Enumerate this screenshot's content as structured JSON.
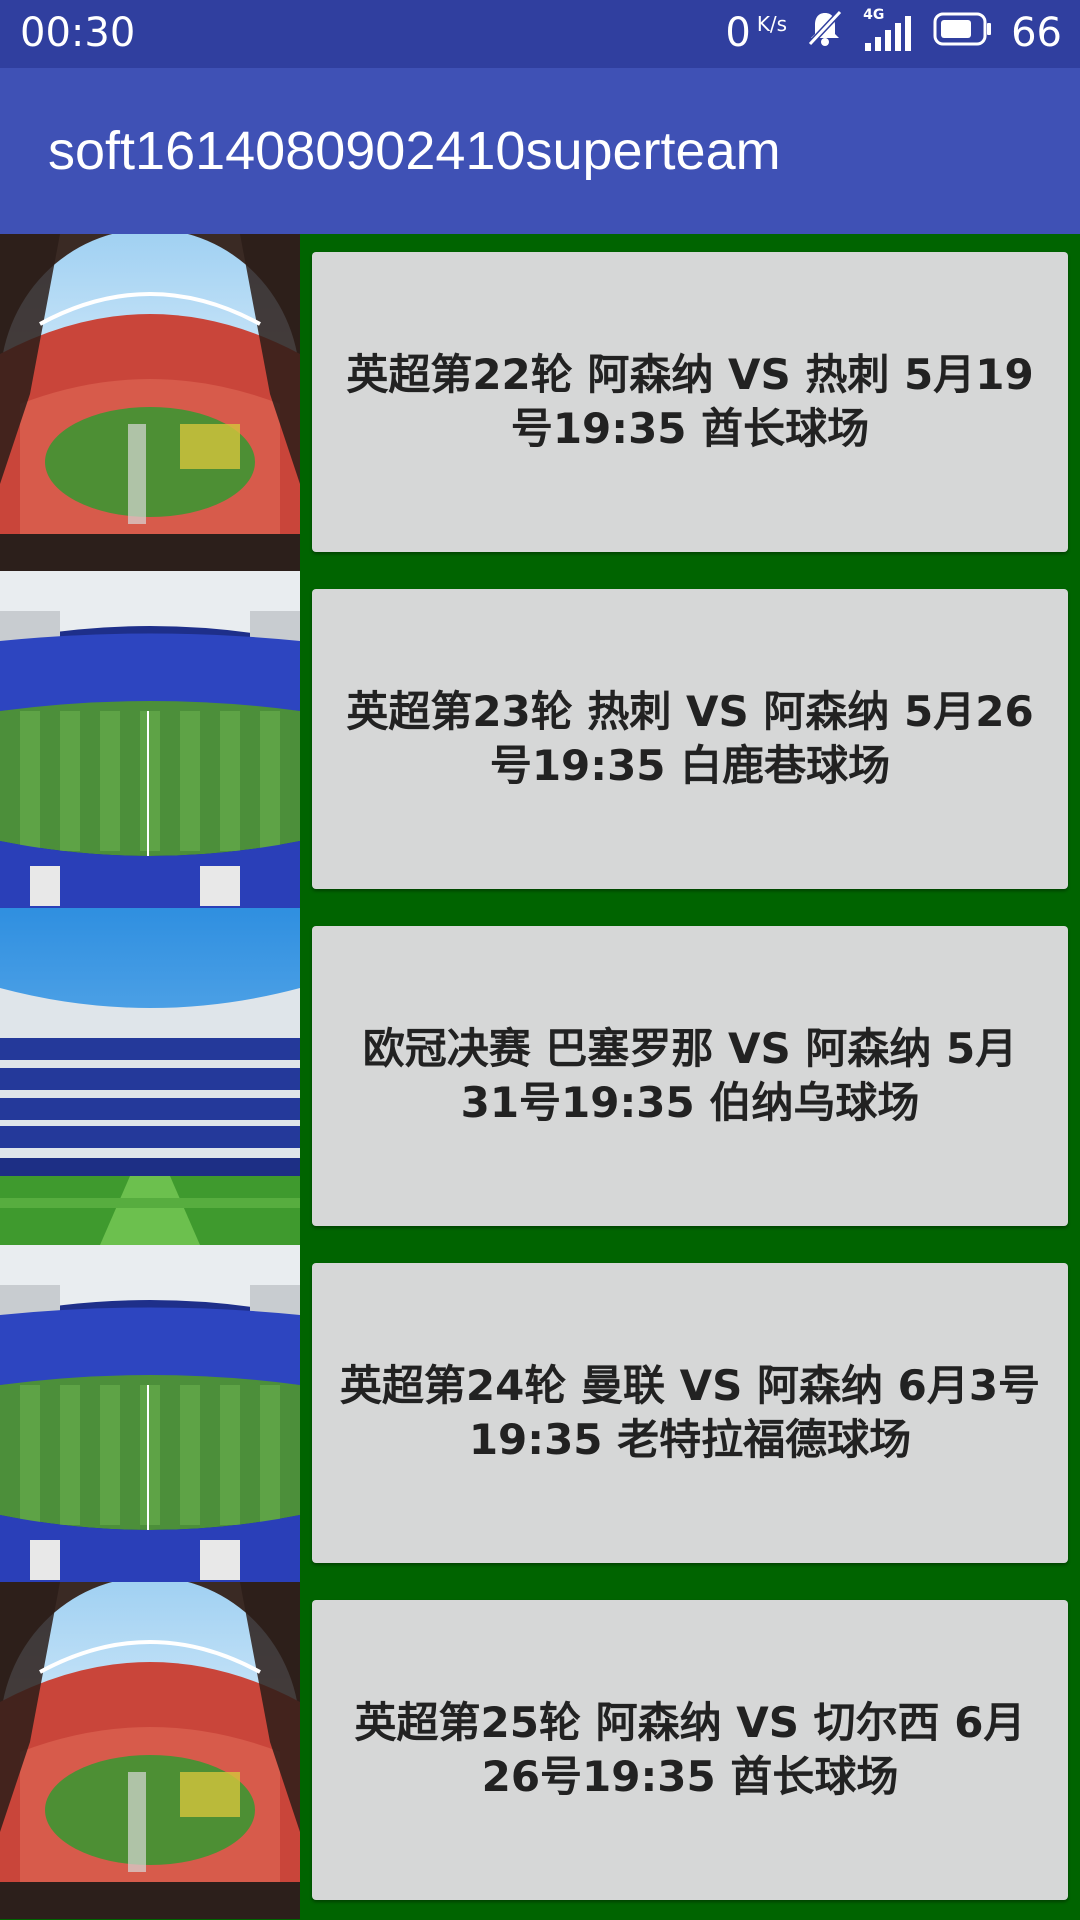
{
  "status_bar": {
    "time": "00:30",
    "net_speed": "0",
    "net_unit": "K/s",
    "network": "4G",
    "battery": "66",
    "icons": [
      "mute-bell-icon",
      "signal-icon",
      "battery-icon"
    ]
  },
  "app_bar": {
    "title": "soft1614080902410superteam",
    "color": "#3f51b5"
  },
  "colors": {
    "list_background": "#006400",
    "status_bar": "#303f9f",
    "card": "#d6d7d7"
  },
  "matches": [
    {
      "text": "英超第22轮  阿森纳 VS 热刺  5月19号19:35 酋长球场",
      "image": "stadium-red-image"
    },
    {
      "text": "英超第23轮 热刺 VS  阿森纳  5月26号19:35 白鹿巷球场",
      "image": "stadium-blue-image"
    },
    {
      "text": "欧冠决赛 巴塞罗那 VS  阿森纳  5月31号19:35 伯纳乌球场",
      "image": "stadium-real-madrid-image"
    },
    {
      "text": "英超第24轮 曼联 VS  阿森纳  6月3号19:35 老特拉福德球场",
      "image": "stadium-blue-image"
    },
    {
      "text": "英超第25轮 阿森纳 VS 切尔西  6月26号19:35 酋长球场",
      "image": "stadium-red-image"
    }
  ]
}
